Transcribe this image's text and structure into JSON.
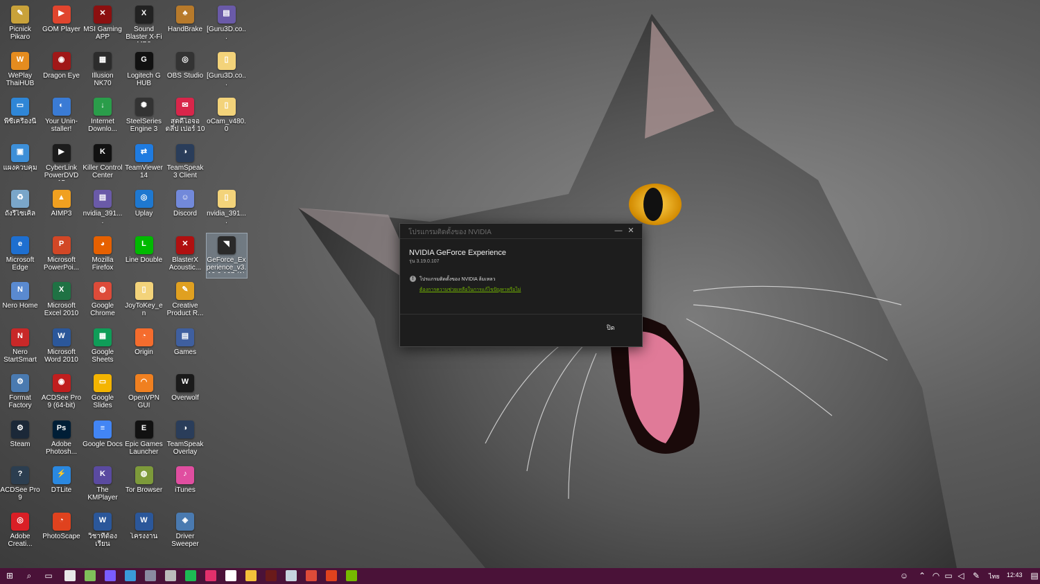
{
  "desktop_icons": [
    {
      "label": "Picnick Pikaro",
      "color": "#c9a23a",
      "glyph": "✎"
    },
    {
      "label": "GOM Player",
      "color": "#e0452e",
      "glyph": "▶"
    },
    {
      "label": "MSI Gaming APP",
      "color": "#8b1010",
      "glyph": "✕"
    },
    {
      "label": "Sound Blaster X-Fi MB3",
      "color": "#222222",
      "glyph": "X"
    },
    {
      "label": "HandBrake",
      "color": "#b77a2b",
      "glyph": "♣"
    },
    {
      "label": "[Guru3D.co...",
      "color": "#6a5aa8",
      "glyph": "▤"
    },
    {
      "label": "WePlay ThaiHUB",
      "color": "#e58c1f",
      "glyph": "W"
    },
    {
      "label": "Dragon Eye",
      "color": "#a01818",
      "glyph": "◉"
    },
    {
      "label": "Illusion NK70",
      "color": "#2c2c2c",
      "glyph": "▦"
    },
    {
      "label": "Logitech G HUB",
      "color": "#111111",
      "glyph": "G"
    },
    {
      "label": "OBS Studio",
      "color": "#333333",
      "glyph": "◎"
    },
    {
      "label": "[Guru3D.co...",
      "color": "#f3d37a",
      "glyph": "▯"
    },
    {
      "label": "พีซีเครื่องนี้",
      "color": "#2f86d6",
      "glyph": "▭"
    },
    {
      "label": "Your Unin-staller!",
      "color": "#3a7bd5",
      "glyph": "◐"
    },
    {
      "label": "Internet Downlo...",
      "color": "#2a9d4a",
      "glyph": "↓"
    },
    {
      "label": "SteelSeries Engine 3",
      "color": "#333333",
      "glyph": "✺"
    },
    {
      "label": "สุดดีไอจอดลึป เปอร์ 10",
      "color": "#d8264a",
      "glyph": "✉"
    },
    {
      "label": "oCam_v480.0",
      "color": "#f3d37a",
      "glyph": "▯"
    },
    {
      "label": "แผงควบคุม",
      "color": "#3d8fd8",
      "glyph": "▣"
    },
    {
      "label": "CyberLink PowerDVD 15",
      "color": "#1c1c1c",
      "glyph": "▶"
    },
    {
      "label": "Killer Control Center",
      "color": "#111111",
      "glyph": "K"
    },
    {
      "label": "TeamViewer 14",
      "color": "#1f7be0",
      "glyph": "⇄"
    },
    {
      "label": "TeamSpeak 3 Client",
      "color": "#2a3d5a",
      "glyph": "◑"
    },
    {
      "label": "",
      "color": "transparent",
      "glyph": ""
    },
    {
      "label": "ถังรีไซเคิล",
      "color": "#7aa6c9",
      "glyph": "♻"
    },
    {
      "label": "AIMP3",
      "color": "#f0a020",
      "glyph": "▲"
    },
    {
      "label": "nvidia_391....",
      "color": "#6a5aa8",
      "glyph": "▤"
    },
    {
      "label": "Uplay",
      "color": "#1e78d0",
      "glyph": "◎"
    },
    {
      "label": "Discord",
      "color": "#7289da",
      "glyph": "☺"
    },
    {
      "label": "nvidia_391....",
      "color": "#f3d37a",
      "glyph": "▯"
    },
    {
      "label": "Microsoft Edge",
      "color": "#1e6fd0",
      "glyph": "e"
    },
    {
      "label": "Microsoft PowerPoi...",
      "color": "#d24726",
      "glyph": "P"
    },
    {
      "label": "Mozilla Firefox",
      "color": "#e66000",
      "glyph": "◕"
    },
    {
      "label": "Line Double",
      "color": "#00b900",
      "glyph": "L"
    },
    {
      "label": "BlasterX Acoustic...",
      "color": "#b01010",
      "glyph": "✕"
    },
    {
      "label": "GeForce_Experience_v3.19.0.107 (1)",
      "color": "#2a2a2a",
      "glyph": "◥"
    },
    {
      "label": "Nero Home",
      "color": "#5a8ad0",
      "glyph": "N"
    },
    {
      "label": "Microsoft Excel 2010",
      "color": "#1f7244",
      "glyph": "X"
    },
    {
      "label": "Google Chrome",
      "color": "#dd4b39",
      "glyph": "◍"
    },
    {
      "label": "JoyToKey_en",
      "color": "#f3d37a",
      "glyph": "▯"
    },
    {
      "label": "Creative Product R...",
      "color": "#e0a020",
      "glyph": "✎"
    },
    {
      "label": "",
      "color": "transparent",
      "glyph": ""
    },
    {
      "label": "Nero StartSmart",
      "color": "#c82828",
      "glyph": "N"
    },
    {
      "label": "Microsoft Word 2010",
      "color": "#2b579a",
      "glyph": "W"
    },
    {
      "label": "Google Sheets",
      "color": "#0f9d58",
      "glyph": "▦"
    },
    {
      "label": "Origin",
      "color": "#f56c2d",
      "glyph": "◔"
    },
    {
      "label": "Games",
      "color": "#3f5f9f",
      "glyph": "▤"
    },
    {
      "label": "",
      "color": "transparent",
      "glyph": ""
    },
    {
      "label": "Format Factory",
      "color": "#4a7ab0",
      "glyph": "⚙"
    },
    {
      "label": "ACDSee Pro 9 (64-bit)",
      "color": "#c01e1e",
      "glyph": "◉"
    },
    {
      "label": "Google Slides",
      "color": "#f4b400",
      "glyph": "▭"
    },
    {
      "label": "OpenVPN GUI",
      "color": "#f08020",
      "glyph": "◠"
    },
    {
      "label": "Overwolf",
      "color": "#1a1a1a",
      "glyph": "W"
    },
    {
      "label": "",
      "color": "transparent",
      "glyph": ""
    },
    {
      "label": "Steam",
      "color": "#1b2838",
      "glyph": "⚙"
    },
    {
      "label": "Adobe Photosh...",
      "color": "#001e36",
      "glyph": "Ps"
    },
    {
      "label": "Google Docs",
      "color": "#4285f4",
      "glyph": "≡"
    },
    {
      "label": "Epic Games Launcher",
      "color": "#111111",
      "glyph": "E"
    },
    {
      "label": "TeamSpeak Overlay",
      "color": "#2a3d5a",
      "glyph": "◑"
    },
    {
      "label": "",
      "color": "transparent",
      "glyph": ""
    },
    {
      "label": "ACDSee Pro 9",
      "color": "#2c3e50",
      "glyph": "?"
    },
    {
      "label": "DTLite",
      "color": "#2a88e0",
      "glyph": "⚡"
    },
    {
      "label": "The KMPlayer",
      "color": "#5a4aa0",
      "glyph": "K"
    },
    {
      "label": "Tor Browser",
      "color": "#7d9a3a",
      "glyph": "◍"
    },
    {
      "label": "iTunes",
      "color": "#e04ea0",
      "glyph": "♪"
    },
    {
      "label": "",
      "color": "transparent",
      "glyph": ""
    },
    {
      "label": "Adobe Creati...",
      "color": "#da1f26",
      "glyph": "◎"
    },
    {
      "label": "PhotoScape",
      "color": "#e0421e",
      "glyph": "◔"
    },
    {
      "label": "วิชาที่ต้องเรียน",
      "color": "#2b579a",
      "glyph": "W"
    },
    {
      "label": "โครงงาน",
      "color": "#2b579a",
      "glyph": "W"
    },
    {
      "label": "Driver Sweeper",
      "color": "#4a7ab0",
      "glyph": "◈"
    }
  ],
  "installer": {
    "title": "โปรแกรมติดตั้งของ NVIDIA",
    "product_name": "NVIDIA GeForce Experience",
    "version": "รุ่น 3.19.0.107",
    "status": "โปรแกรมติดตั้งของ NVIDIA ล้มเหลว",
    "help_link": "ต้องการความช่วยเหลือในการแก้ไขปัญหาหรือไม่",
    "close_label": "ปิด",
    "minimize_glyph": "—",
    "close_glyph": "✕",
    "accent_color": "#76b900"
  },
  "taskbar": {
    "background": "#4a1238",
    "start_glyph": "⊞",
    "search_glyph": "⌕",
    "taskview_glyph": "▭",
    "pinned": [
      {
        "name": "store",
        "color": "#e8e8e8"
      },
      {
        "name": "screen",
        "color": "#7fbf5a"
      },
      {
        "name": "app-a",
        "color": "#7a5cff"
      },
      {
        "name": "app-b",
        "color": "#3a9ad9"
      },
      {
        "name": "app-c",
        "color": "#8a8aa0"
      },
      {
        "name": "obs",
        "color": "#bbbbbb"
      },
      {
        "name": "spotify",
        "color": "#1db954"
      },
      {
        "name": "instagram",
        "color": "#e1306c"
      },
      {
        "name": "mail",
        "color": "#ffffff"
      },
      {
        "name": "explorer",
        "color": "#f3c13a"
      },
      {
        "name": "xbox",
        "color": "#6a1a1a"
      },
      {
        "name": "steam",
        "color": "#c6d4df"
      },
      {
        "name": "chrome",
        "color": "#dd4b39"
      },
      {
        "name": "app-red",
        "color": "#e0421e"
      },
      {
        "name": "geforce",
        "color": "#76b900"
      }
    ],
    "language": "ไทย",
    "clock": "12:43"
  }
}
